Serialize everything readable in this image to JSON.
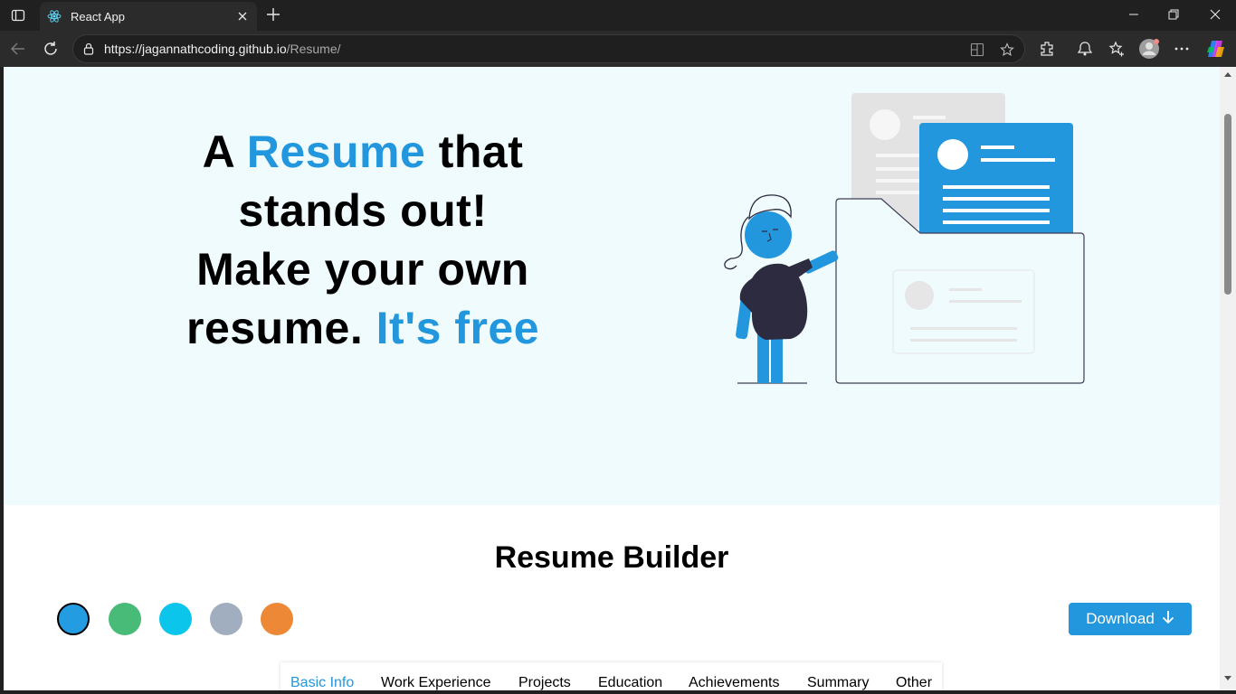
{
  "browser": {
    "tab_title": "React App",
    "url_host": "https://jagannathcoding.github.io",
    "url_path": "/Resume/"
  },
  "hero": {
    "line1_a": "A ",
    "line1_accent": "Resume",
    "line1_b": " that",
    "line2": "stands out!",
    "line3": "Make your own",
    "line4_a": "resume. ",
    "line4_accent": "It's free"
  },
  "builder": {
    "title": "Resume Builder",
    "download_label": "Download",
    "colors": [
      "#239ce2",
      "#48bb78",
      "#0bc5ea",
      "#a0aec0",
      "#ed8936"
    ],
    "tabs": [
      "Basic Info",
      "Work Experience",
      "Projects",
      "Education",
      "Achievements",
      "Summary",
      "Other"
    ],
    "active_tab": "Basic Info"
  },
  "icons": {
    "favicon": "react-logo-icon",
    "download": "arrow-down-icon"
  }
}
